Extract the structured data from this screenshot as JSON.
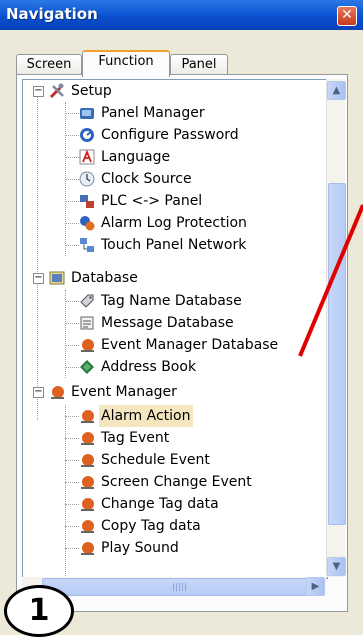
{
  "window": {
    "title": "Navigation",
    "close_glyph": "✕"
  },
  "tabs": [
    {
      "label": "Screen",
      "active": false
    },
    {
      "label": "Function",
      "active": true
    },
    {
      "label": "Panel",
      "active": false
    }
  ],
  "tree": {
    "groups": [
      {
        "label": "Setup",
        "icon": "tools-icon",
        "expander": "−",
        "items": [
          {
            "label": "Panel Manager",
            "icon": "panel-manager-icon"
          },
          {
            "label": "Configure Password",
            "icon": "password-icon"
          },
          {
            "label": "Language",
            "icon": "language-icon"
          },
          {
            "label": "Clock Source",
            "icon": "clock-icon"
          },
          {
            "label": "PLC <-> Panel",
            "icon": "plc-panel-icon"
          },
          {
            "label": "Alarm Log Protection",
            "icon": "alarm-log-icon"
          },
          {
            "label": "Touch Panel Network",
            "icon": "network-icon"
          }
        ]
      },
      {
        "label": "Database",
        "icon": "database-icon",
        "expander": "−",
        "items": [
          {
            "label": "Tag Name Database",
            "icon": "tag-icon"
          },
          {
            "label": "Message Database",
            "icon": "message-icon"
          },
          {
            "label": "Event Manager Database",
            "icon": "event-db-icon"
          },
          {
            "label": "Address Book",
            "icon": "address-book-icon"
          }
        ]
      },
      {
        "label": "Event Manager",
        "icon": "event-manager-icon",
        "expander": "−",
        "items": [
          {
            "label": "Alarm Action",
            "icon": "event-icon",
            "selected": true
          },
          {
            "label": "Tag Event",
            "icon": "event-icon"
          },
          {
            "label": "Schedule Event",
            "icon": "event-icon"
          },
          {
            "label": "Screen Change Event",
            "icon": "event-icon"
          },
          {
            "label": "Change Tag data",
            "icon": "event-icon"
          },
          {
            "label": "Copy Tag data",
            "icon": "event-icon"
          },
          {
            "label": "Play Sound",
            "icon": "event-icon"
          }
        ]
      }
    ]
  },
  "scroll": {
    "up": "▲",
    "down": "▼",
    "right": "▶"
  },
  "annotation": {
    "number": "1",
    "arrow_color": "#e00000"
  },
  "colors": {
    "titlebar": "#0a4fd0",
    "selection": "#f4e7c0",
    "accent_tab": "#f0a030"
  }
}
